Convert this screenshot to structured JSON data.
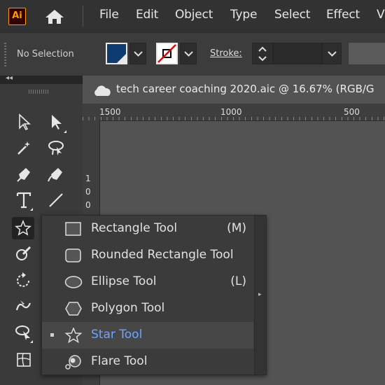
{
  "app": {
    "logo_text": "Ai"
  },
  "menu": [
    "File",
    "Edit",
    "Object",
    "Type",
    "Select",
    "Effect",
    "V"
  ],
  "control_bar": {
    "selection_status": "No Selection",
    "fill_color": "#0f3c70",
    "stroke_label": "Stroke:",
    "stroke_value": ""
  },
  "document": {
    "title": "tech career coaching 2020.aic @ 16.67% (RGB/G"
  },
  "ruler": {
    "top_labels": [
      "1500",
      "1000",
      "500"
    ],
    "left_digits": [
      "1",
      "0",
      "0"
    ]
  },
  "toolbar": {
    "tools": [
      "selection-tool",
      "direct-selection-tool",
      "magic-wand-tool",
      "lasso-tool",
      "pen-tool",
      "curvature-tool",
      "type-tool",
      "line-segment-tool",
      "star-tool",
      "shaper-tool",
      "rotate-tool",
      "warp-tool",
      "free-transform-tool",
      "mesh-tool"
    ]
  },
  "flyout": {
    "items": [
      {
        "label": "Rectangle Tool",
        "shortcut": "(M)",
        "icon": "rectangle-icon"
      },
      {
        "label": "Rounded Rectangle Tool",
        "shortcut": "",
        "icon": "rounded-rectangle-icon"
      },
      {
        "label": "Ellipse Tool",
        "shortcut": "(L)",
        "icon": "ellipse-icon"
      },
      {
        "label": "Polygon Tool",
        "shortcut": "",
        "icon": "polygon-icon"
      },
      {
        "label": "Star Tool",
        "shortcut": "",
        "icon": "star-icon",
        "active": true
      },
      {
        "label": "Flare Tool",
        "shortcut": "",
        "icon": "flare-icon"
      }
    ],
    "active_color": "#6fa4ff"
  }
}
